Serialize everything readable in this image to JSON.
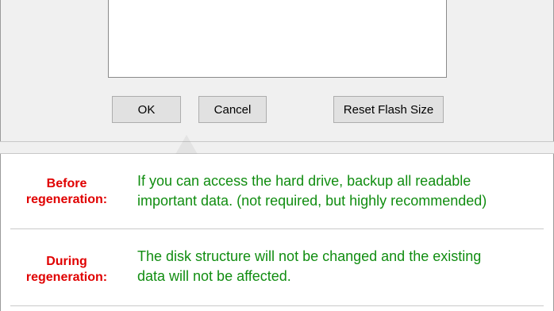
{
  "buttons": {
    "ok": "OK",
    "cancel": "Cancel",
    "reset_flash_size": "Reset Flash Size"
  },
  "info": {
    "before": {
      "label_line1": "Before",
      "label_line2": "regeneration:",
      "text_line1": "If you can access the hard drive, backup all readable",
      "text_line2": "important data. (not required, but highly recommended)"
    },
    "during": {
      "label_line1": "During",
      "label_line2": "regeneration:",
      "text_line1": "The disk structure will not be changed and the existing",
      "text_line2": "data will not be affected."
    }
  },
  "colors": {
    "label": "#e00000",
    "text": "#118d11"
  }
}
